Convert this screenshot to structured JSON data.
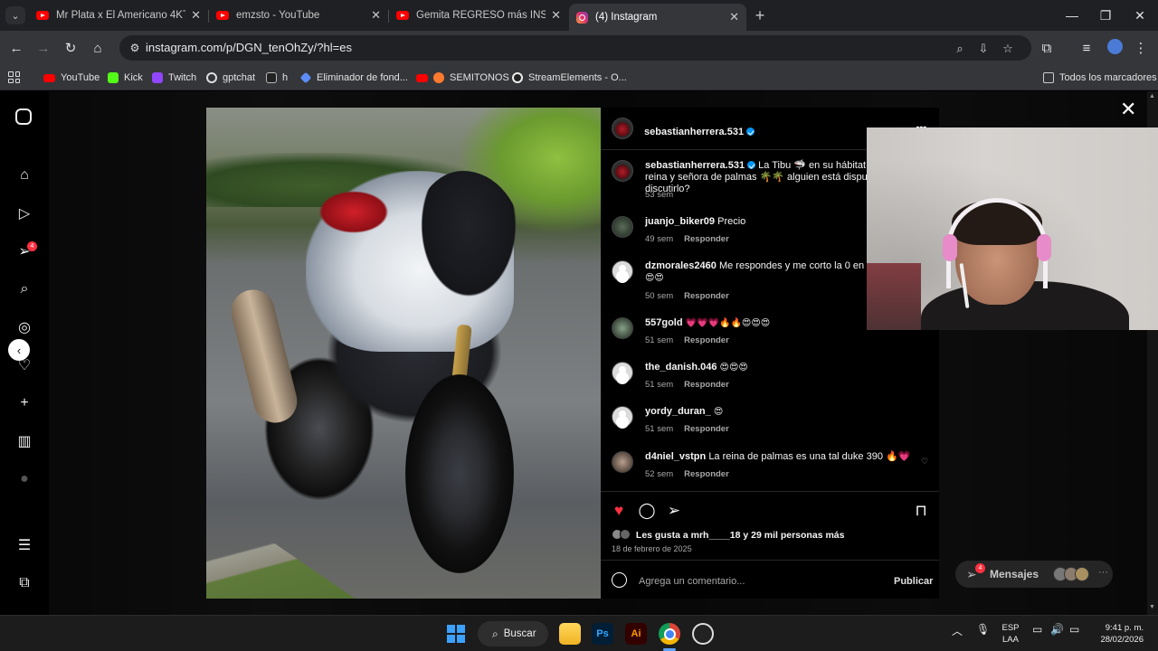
{
  "browser": {
    "tabs": [
      {
        "title": "Mr Plata x El Americano 4KT - L",
        "favicon": "youtube-icon",
        "active": false
      },
      {
        "title": "emzsto - YouTube",
        "favicon": "youtube-icon",
        "active": false
      },
      {
        "title": "Gemita REGRESÓ más INSOPOR",
        "favicon": "youtube-icon",
        "active": false
      },
      {
        "title": "(4) Instagram",
        "favicon": "instagram-icon",
        "active": true
      }
    ],
    "url": "instagram.com/p/DGN_tenOhZy/?hl=es",
    "bookmarks": [
      {
        "label": "YouTube",
        "icon": "youtube-icon"
      },
      {
        "label": "Kick",
        "icon": "kick-icon"
      },
      {
        "label": "Twitch",
        "icon": "twitch-icon"
      },
      {
        "label": "gptchat",
        "icon": "openai-icon"
      },
      {
        "label": "h",
        "icon": "hat-icon"
      },
      {
        "label": "Eliminador de fond...",
        "icon": "diamond-icon"
      },
      {
        "label": "SEMITONOS",
        "icon": "youtube-icon"
      },
      {
        "label": "StreamElements - O...",
        "icon": "streamelements-icon"
      }
    ],
    "all_bookmarks": "Todos los marcadores"
  },
  "instagram": {
    "sidebar_badge": "4",
    "post": {
      "author": "sebastianherrera.531",
      "caption_author": "sebastianherrera.531",
      "caption": "La Tibu 🦈 en su hábitat natural, la reina y señora de palmas 🌴🌴 alguien está dispuesto a discutirlo?",
      "caption_time": "53 sem",
      "comments": [
        {
          "user": "juanjo_biker09",
          "text": "Precio",
          "time": "49 sem",
          "reply": "Responder"
        },
        {
          "user": "dzmorales2460",
          "text": "Me respondes y me corto la 0 en el p",
          "text2": "😍😍",
          "time": "50 sem",
          "reply": "Responder"
        },
        {
          "user": "557gold",
          "text": "💗💗💗🔥🔥😍😍😍",
          "time": "51 sem",
          "reply": "Responder"
        },
        {
          "user": "the_danish.046",
          "text": "😍😍😍",
          "time": "51 sem",
          "reply": "Responder"
        },
        {
          "user": "yordy_duran_",
          "text": "😍",
          "time": "51 sem",
          "reply": "Responder"
        },
        {
          "user": "d4niel_vstpn",
          "text": "La reina de palmas es una tal duke 390 🔥💗",
          "time": "52 sem",
          "reply": "Responder"
        }
      ],
      "likes_text": "Les gusta a mrh____18 y 29 mil personas más",
      "date": "18 de febrero de 2025",
      "comment_placeholder": "Agrega un comentario...",
      "publish": "Publicar"
    },
    "messages": {
      "label": "Mensajes",
      "badge": "4"
    }
  },
  "taskbar": {
    "search": "Buscar",
    "apps": [
      "file-explorer-icon",
      "photoshop-icon",
      "illustrator-icon",
      "chrome-icon",
      "obs-icon"
    ],
    "ps_label": "Ps",
    "ai_label": "Ai",
    "lang_line1": "ESP",
    "lang_line2": "LAA",
    "time": "9:41 p. m.",
    "date": "28/02/2026"
  },
  "colors": {
    "like_red": "#ff3040",
    "verified_blue": "#0095f6",
    "chrome_dark": "#35363a"
  }
}
